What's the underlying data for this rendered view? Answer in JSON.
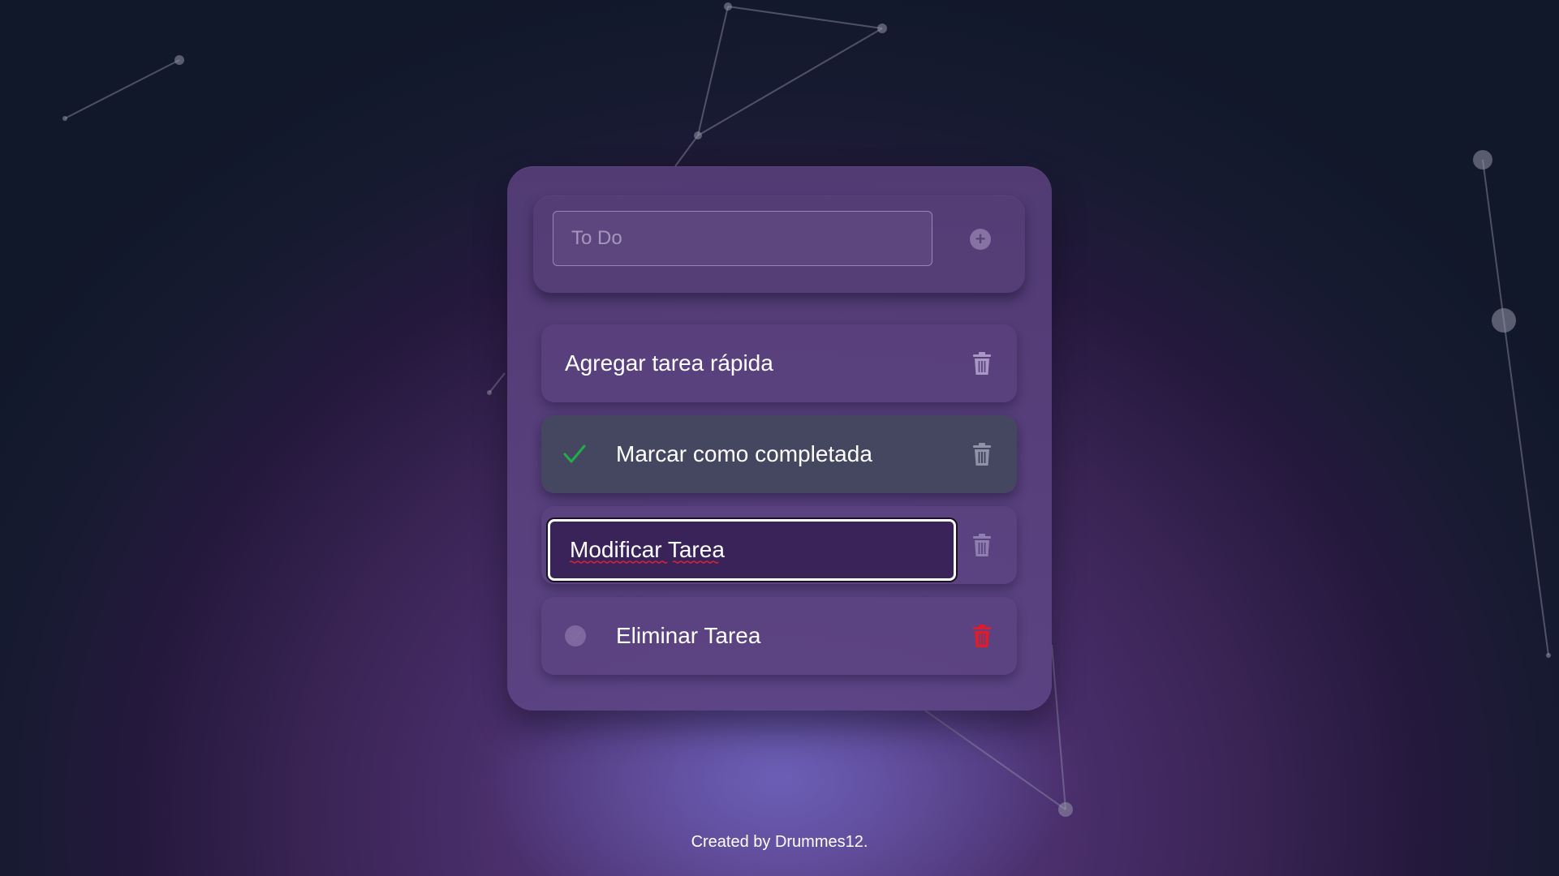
{
  "input": {
    "placeholder": "To Do",
    "value": ""
  },
  "add_button": {
    "icon": "plus-circle-icon",
    "glyph": "+"
  },
  "tasks": [
    {
      "label": "Agregar tarea rápida",
      "completed": false,
      "check_shown": false,
      "trash_color": "#a998c4"
    },
    {
      "label": "Marcar como completada",
      "completed": true,
      "check_shown": true,
      "check_color": "#1fae4a",
      "trash_color": "#a998c4"
    },
    {
      "label": "Modificar Tarea",
      "editing": true,
      "trash_color": "#a998c4"
    },
    {
      "label": "Eliminar Tarea",
      "completed": false,
      "check_shown": true,
      "trash_color": "#e01b2a"
    }
  ],
  "footer": {
    "text": "Created by Drummes12."
  },
  "colors": {
    "background_dark": "#111829",
    "background_purple": "#4a2f6c",
    "card": "#5a4284",
    "completed_task": "#44485f",
    "check_green": "#1fae4a",
    "delete_red": "#e01b2a"
  }
}
